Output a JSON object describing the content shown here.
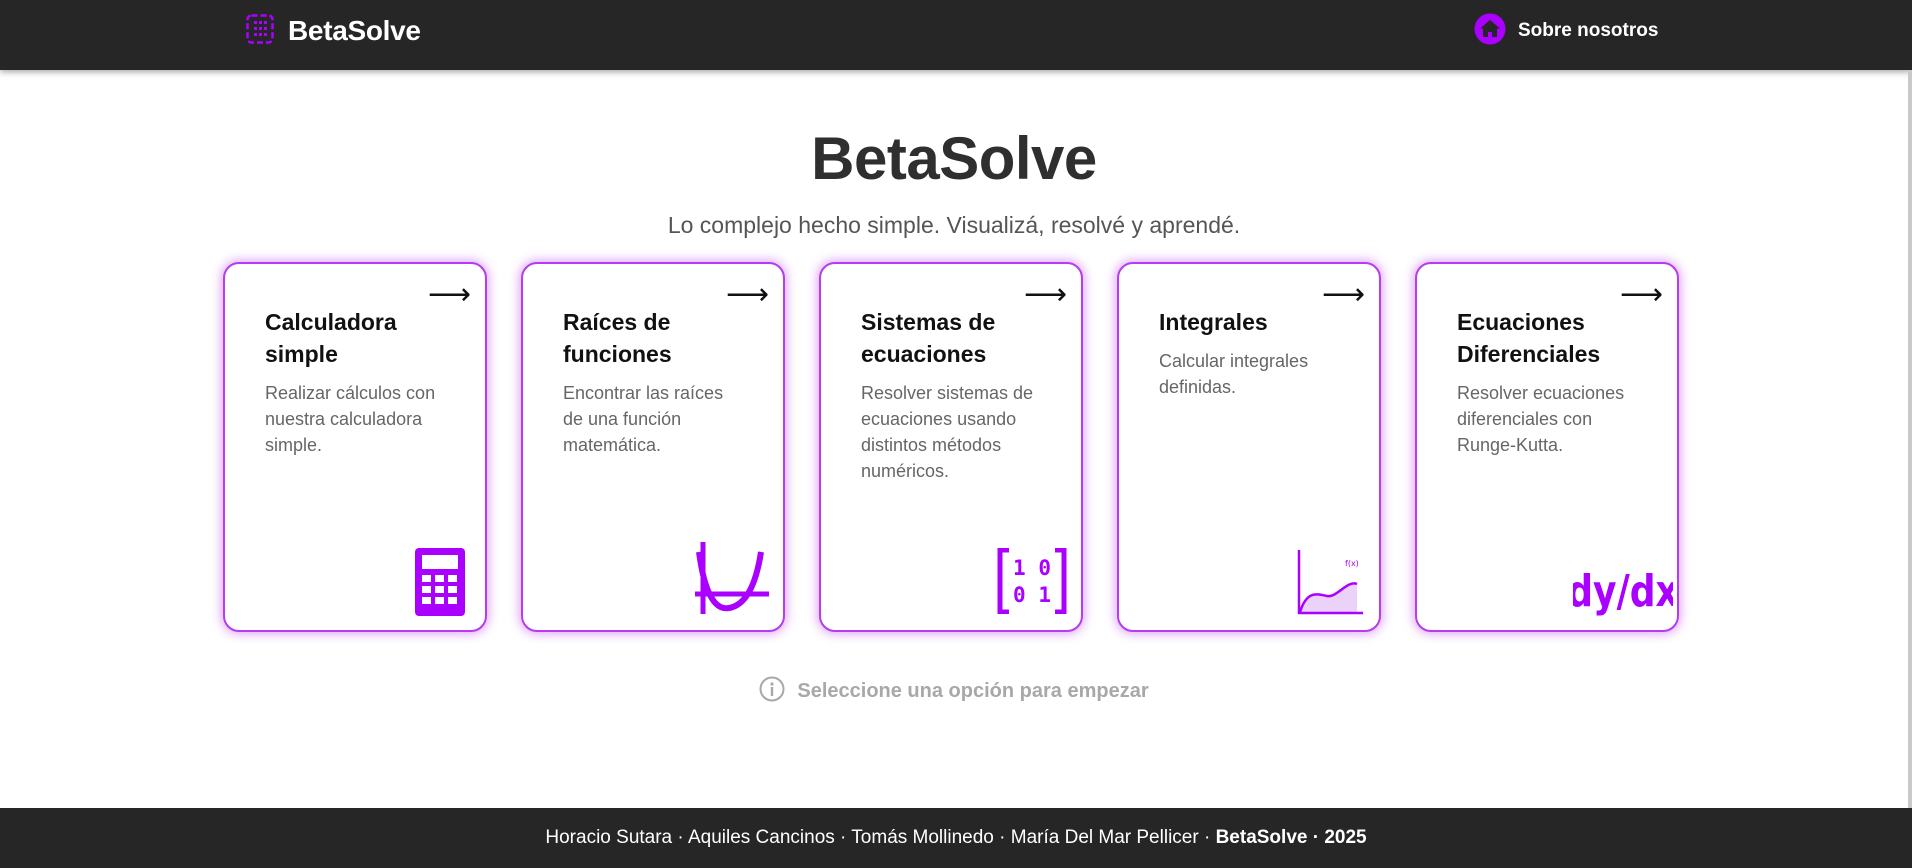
{
  "app": {
    "brand": "BetaSolve",
    "accent": "#aa00ff"
  },
  "nav": {
    "about_label": "Sobre nosotros",
    "about_icon": "home-icon",
    "brand_icon": "calculator-grid-icon"
  },
  "hero": {
    "title": "BetaSolve",
    "subtitle": "Lo complejo hecho simple. Visualizá, resolvé y aprendé."
  },
  "cards": [
    {
      "title": "Calculadora simple",
      "description": "Realizar cálculos con nuestra calculadora simple.",
      "arrow": "⟶",
      "icon": "calculator-icon"
    },
    {
      "title": "Raíces de funciones",
      "description": "Encontrar las raíces de una función matemática.",
      "arrow": "⟶",
      "icon": "parabola-icon"
    },
    {
      "title": "Sistemas de ecuaciones",
      "description": "Resolver sistemas de ecuaciones usando distintos métodos numéricos.",
      "arrow": "⟶",
      "icon": "matrix-icon",
      "icon_text": {
        "row1": "1 0",
        "row2": "0 1"
      }
    },
    {
      "title": "Integrales",
      "description": "Calcular integrales definidas.",
      "arrow": "⟶",
      "icon": "area-under-curve-icon",
      "icon_text": {
        "fx": "f(x)"
      }
    },
    {
      "title": "Ecuaciones Diferenciales",
      "description": "Resolver ecuaciones diferenciales con Runge-Kutta.",
      "arrow": "⟶",
      "icon": "derivative-icon",
      "icon_text": {
        "dydx": "dy/dx"
      }
    }
  ],
  "hint": {
    "text": "Seleccione una opción para empezar",
    "icon": "info-icon"
  },
  "footer": {
    "authors": "Horacio Sutara · Aquiles Cancinos · Tomás Mollinedo · María Del Mar Pellicer · ",
    "brand_year": "BetaSolve · 2025"
  }
}
